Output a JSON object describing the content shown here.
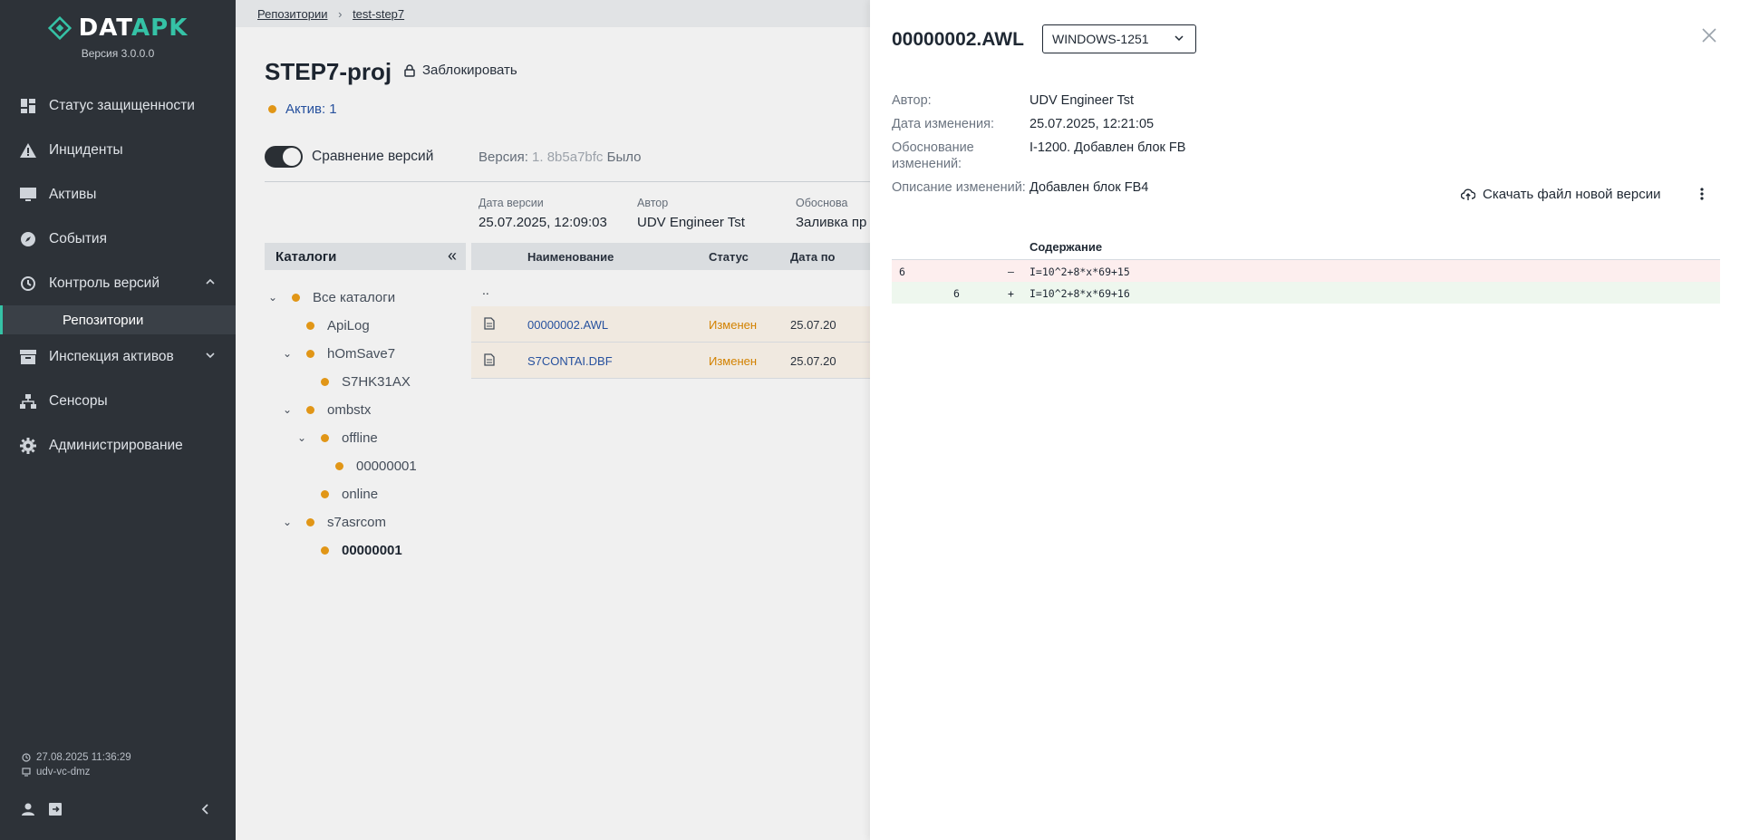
{
  "app": {
    "logo_text_prefix": "DAT",
    "logo_text_accent": "APK",
    "version": "Версия 3.0.0.0"
  },
  "nav": {
    "items": [
      {
        "label": "Статус защищенности",
        "icon": "dashboard-icon"
      },
      {
        "label": "Инциденты",
        "icon": "warning-icon"
      },
      {
        "label": "Активы",
        "icon": "monitor-icon"
      },
      {
        "label": "События",
        "icon": "compass-icon"
      },
      {
        "label": "Контроль версий",
        "icon": "history-icon"
      },
      {
        "label": "Инспекция активов",
        "icon": "archive-icon"
      },
      {
        "label": "Сенсоры",
        "icon": "sensor-icon"
      },
      {
        "label": "Администрирование",
        "icon": "gear-icon"
      }
    ],
    "sub_item": "Репозитории"
  },
  "footer": {
    "datetime": "27.08.2025  11:36:29",
    "host": "udv-vc-dmz"
  },
  "breadcrumb": {
    "root": "Репозитории",
    "current": "test-step7"
  },
  "project": {
    "title": "STEP7-proj",
    "lock_label": "Заблокировать",
    "assets_label": "Актив: 1",
    "compare_label": "Сравнение версий",
    "version_prefix": "Версия:",
    "version_value": "1. 8b5a7bfc",
    "version_suffix": "Было"
  },
  "meta": {
    "date_label": "Дата версии",
    "date_value": "25.07.2025, 12:09:03",
    "author_label": "Автор",
    "author_value": "UDV Engineer Tst",
    "reason_label": "Обоснова",
    "reason_value": "Заливка пр"
  },
  "catalog": {
    "header": "Каталоги",
    "nodes": [
      {
        "label": "Все каталоги",
        "toggle": "⌄"
      },
      {
        "label": "ApiLog",
        "toggle": ""
      },
      {
        "label": "hOmSave7",
        "toggle": "⌄"
      },
      {
        "label": "S7HK31AX",
        "toggle": ""
      },
      {
        "label": "ombstx",
        "toggle": "⌄"
      },
      {
        "label": "offline",
        "toggle": "⌄"
      },
      {
        "label": "00000001",
        "toggle": ""
      },
      {
        "label": "online",
        "toggle": ""
      },
      {
        "label": "s7asrcom",
        "toggle": "⌄"
      },
      {
        "label": "00000001",
        "toggle": ""
      }
    ]
  },
  "files": {
    "col_name": "Наименование",
    "col_status": "Статус",
    "col_date": "Дата по",
    "up_label": "..",
    "rows": [
      {
        "name": "00000002.AWL",
        "status": "Изменен",
        "date": "25.07.20"
      },
      {
        "name": "S7CONTAI.DBF",
        "status": "Изменен",
        "date": "25.07.20"
      }
    ]
  },
  "drawer": {
    "title": "00000002.AWL",
    "encoding": "WINDOWS-1251",
    "props": [
      {
        "key": "Автор:",
        "value": "UDV Engineer Tst"
      },
      {
        "key": "Дата изменения:",
        "value": "25.07.2025, 12:21:05"
      },
      {
        "key": "Обоснование изменений:",
        "value": "I-1200. Добавлен блок FB"
      },
      {
        "key": "Описание изменений:",
        "value": "Добавлен блок FB4"
      }
    ],
    "download_label": "Скачать файл новой версии",
    "content_header": "Содержание",
    "diff": [
      {
        "old": "6",
        "new": "",
        "sign": "–",
        "text": "I=10^2+8*x*69+15"
      },
      {
        "old": "",
        "new": "6",
        "sign": "+",
        "text": "I=10^2+8*x*69+16"
      }
    ]
  },
  "colors": {
    "sidebar_bg": "#2d3238",
    "accent": "#35c2a6",
    "status_orange": "#f0a019",
    "link_blue": "#2a57a8"
  }
}
